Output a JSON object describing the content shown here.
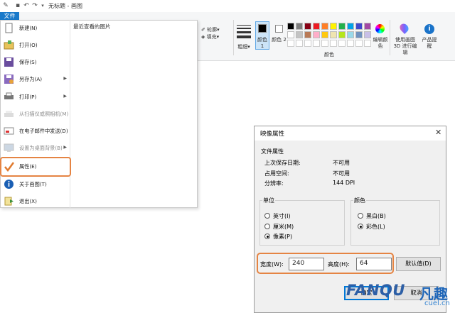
{
  "window": {
    "title": "无标题 - 画图",
    "file_tab": "文件"
  },
  "ribbon": {
    "outline_label": "轮廓",
    "fill_label": "填充",
    "size_label": "粗细",
    "color1_label": "颜色 1",
    "color2_label": "颜色 2",
    "colors_group_label": "颜色",
    "edit_colors_label": "编辑颜色",
    "paint3d_label": "使用画图 3D 进行编辑",
    "product_alert_label": "产品提醒",
    "palette_row1": [
      "#000000",
      "#7f7f7f",
      "#880015",
      "#ed1c24",
      "#ff7f27",
      "#fff200",
      "#22b14c",
      "#00a2e8",
      "#3f48cc",
      "#a349a4"
    ],
    "palette_row2": [
      "#ffffff",
      "#c3c3c3",
      "#b97a57",
      "#ffaec9",
      "#ffc90e",
      "#efe4b0",
      "#b5e61d",
      "#99d9ea",
      "#7092be",
      "#c8bfe7"
    ]
  },
  "file_menu": {
    "recent_title": "最近查看的图片",
    "items": [
      {
        "label": "新建(N)",
        "icon": "new-file-icon",
        "disabled": false,
        "submenu": false
      },
      {
        "label": "打开(O)",
        "icon": "open-folder-icon",
        "disabled": false,
        "submenu": false
      },
      {
        "label": "保存(S)",
        "icon": "save-icon",
        "disabled": false,
        "submenu": false
      },
      {
        "label": "另存为(A)",
        "icon": "save-as-icon",
        "disabled": false,
        "submenu": true
      },
      {
        "label": "打印(P)",
        "icon": "printer-icon",
        "disabled": false,
        "submenu": true
      },
      {
        "label": "从扫描仪或照相机(M)",
        "icon": "scanner-icon",
        "disabled": true,
        "submenu": false
      },
      {
        "label": "在电子邮件中发送(D)",
        "icon": "email-icon",
        "disabled": false,
        "submenu": false
      },
      {
        "label": "设置为桌面背景(B)",
        "icon": "desktop-background-icon",
        "disabled": true,
        "submenu": true
      },
      {
        "label": "属性(E)",
        "icon": "checkmark-icon",
        "disabled": false,
        "submenu": false
      },
      {
        "label": "关于画图(T)",
        "icon": "info-icon",
        "disabled": false,
        "submenu": false
      },
      {
        "label": "退出(X)",
        "icon": "exit-icon",
        "disabled": false,
        "submenu": false
      }
    ]
  },
  "dialog": {
    "title": "映像属性",
    "file_props_label": "文件属性",
    "last_saved_label": "上次保存日期:",
    "last_saved_value": "不可用",
    "disk_size_label": "占用空间:",
    "disk_size_value": "不可用",
    "resolution_label": "分辨率:",
    "resolution_value": "144 DPI",
    "units_label": "单位",
    "unit_inches": "英寸(I)",
    "unit_cm": "厘米(M)",
    "unit_pixels": "像素(P)",
    "units_selected": "pixels",
    "colors_label": "颜色",
    "color_bw": "黑白(B)",
    "color_color": "彩色(L)",
    "colors_selected": "color",
    "width_label": "宽度(W):",
    "width_value": "240",
    "height_label": "高度(H):",
    "height_value": "64",
    "default_button": "默认值(D)",
    "ok_button": "确定",
    "cancel_button": "取消"
  },
  "watermark": {
    "brand": "FANQU",
    "brand_cn": "凡趣",
    "url": "cuel.cn"
  }
}
